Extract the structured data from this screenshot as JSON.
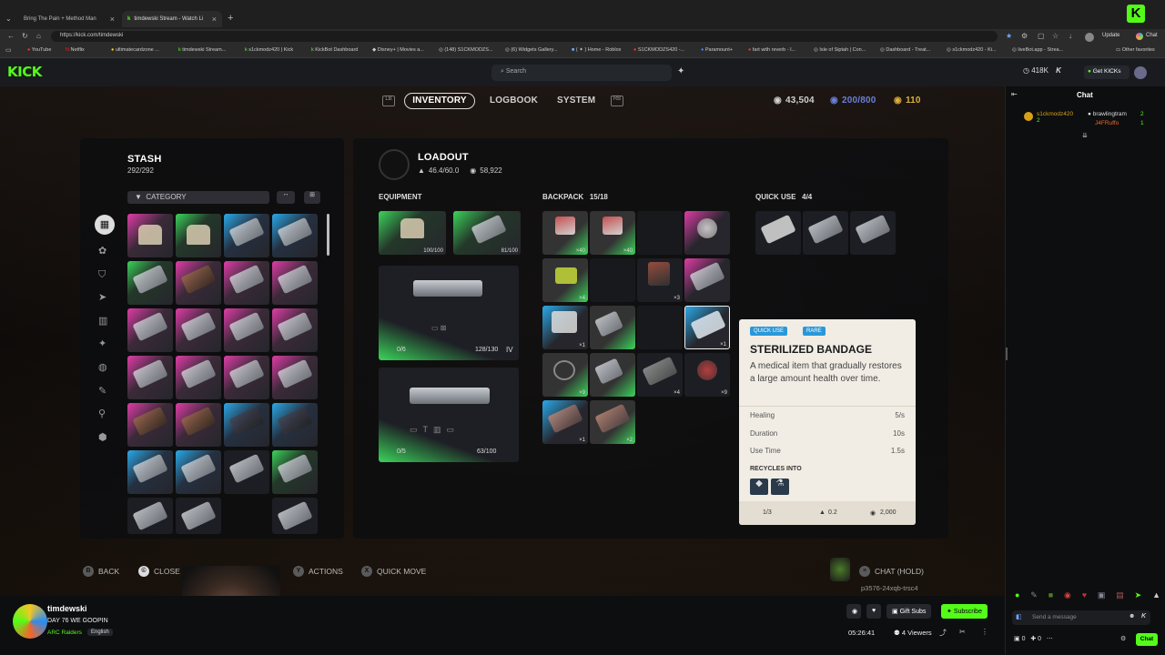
{
  "browser": {
    "tabs": [
      {
        "title": "Bring The Pain + Method Man"
      },
      {
        "title": "timdewski Stream - Watch Li"
      }
    ],
    "url": "https://kick.com/timdewski",
    "update_label": "Update",
    "chat_label": "Chat",
    "bookmarks": [
      "YouTube",
      "Netflix",
      "ultimatecardzone ...",
      "timdewski Stream...",
      "s1ckmodz420 | Kick",
      "KickBot Dashboard",
      "Disney+ | Movies a...",
      "(148) S1CKMODZS...",
      "(6) Widgets Gallery...",
      "( ✦ ) Home - Roblox",
      "S1CKMODZS420 -...",
      "Paramount+",
      "fart with reverb - I...",
      "Isle of Siptah | Con...",
      "Dashboard - Treat...",
      "s1ckmodz420 - Ki...",
      "liveBot.app - Strea...",
      "Other favorites"
    ]
  },
  "kick": {
    "logo": "KICK",
    "search_placeholder": "Search",
    "viewers_badge": "418K",
    "get_kicks": "Get KICKs",
    "chat_title": "Chat",
    "chat_users": [
      {
        "name": "s1ckmodz420",
        "count": "2"
      },
      {
        "name": "brawlingtram",
        "count": "2"
      },
      {
        "name": "J4FRuffo",
        "count": "1"
      }
    ],
    "message_placeholder": "Send a message",
    "chat_send": "Chat",
    "chat_counts": [
      "0",
      "0"
    ]
  },
  "game": {
    "tabs": [
      "INVENTORY",
      "LOGBOOK",
      "SYSTEM"
    ],
    "currency": {
      "coins": "43,504",
      "capacity": "200/800",
      "tokens": "110"
    },
    "stash": {
      "title": "STASH",
      "count": "292/292",
      "category_label": "CATEGORY"
    },
    "loadout": {
      "title": "LOADOUT",
      "weight": "46.4/60.0",
      "value": "58,922"
    },
    "equipment_label": "EQUIPMENT",
    "backpack_label": "BACKPACK",
    "backpack_count": "15/18",
    "quick_use_label": "QUICK USE",
    "quick_use_count": "4/4",
    "equipment": {
      "shield_durability": "100/100",
      "augment_durability": "81/100",
      "weapon1_ammo": "0/6",
      "weapon1_durability": "128/130",
      "weapon1_tier": "IV",
      "weapon2_ammo": "0/5",
      "weapon2_durability": "63/100"
    },
    "backpack_counts": [
      "×40",
      "×40",
      "",
      "",
      "×4",
      "",
      "×3",
      "",
      "×1",
      "",
      "",
      "×1",
      "×9",
      "",
      "×4",
      "×9",
      "×1",
      "×2"
    ],
    "quick_use_last_count": "×3",
    "tooltip": {
      "tag1": "QUICK USE",
      "tag2": "RARE",
      "name": "STERILIZED BANDAGE",
      "description": "A medical item that gradually restores a large amount health over time.",
      "stats": [
        {
          "label": "Healing",
          "value": "5/s"
        },
        {
          "label": "Duration",
          "value": "10s"
        },
        {
          "label": "Use Time",
          "value": "1.5s"
        }
      ],
      "recycles_label": "RECYCLES INTO",
      "stack": "1/3",
      "weight": "0.2",
      "price": "2,000"
    },
    "prompts": {
      "back": "BACK",
      "close": "CLOSE",
      "actions": "ACTIONS",
      "quick_move": "QUICK MOVE",
      "chat_hold": "CHAT (HOLD)"
    },
    "player_code": "p3576-24xqb-trsc4"
  },
  "stream": {
    "streamer": "timdewski",
    "title": "DAY 76 WE GOOPIN",
    "category": "ARC Raiders",
    "language": "English",
    "gift_subs": "Gift Subs",
    "subscribe": "Subscribe",
    "uptime": "05:26:41",
    "viewers": "4 Viewers"
  },
  "colors": {
    "kick_green": "#53fc18",
    "rarity_pink": "#e03ca8",
    "rarity_blue": "#2aa9e8",
    "rarity_green": "#3bd45a"
  }
}
